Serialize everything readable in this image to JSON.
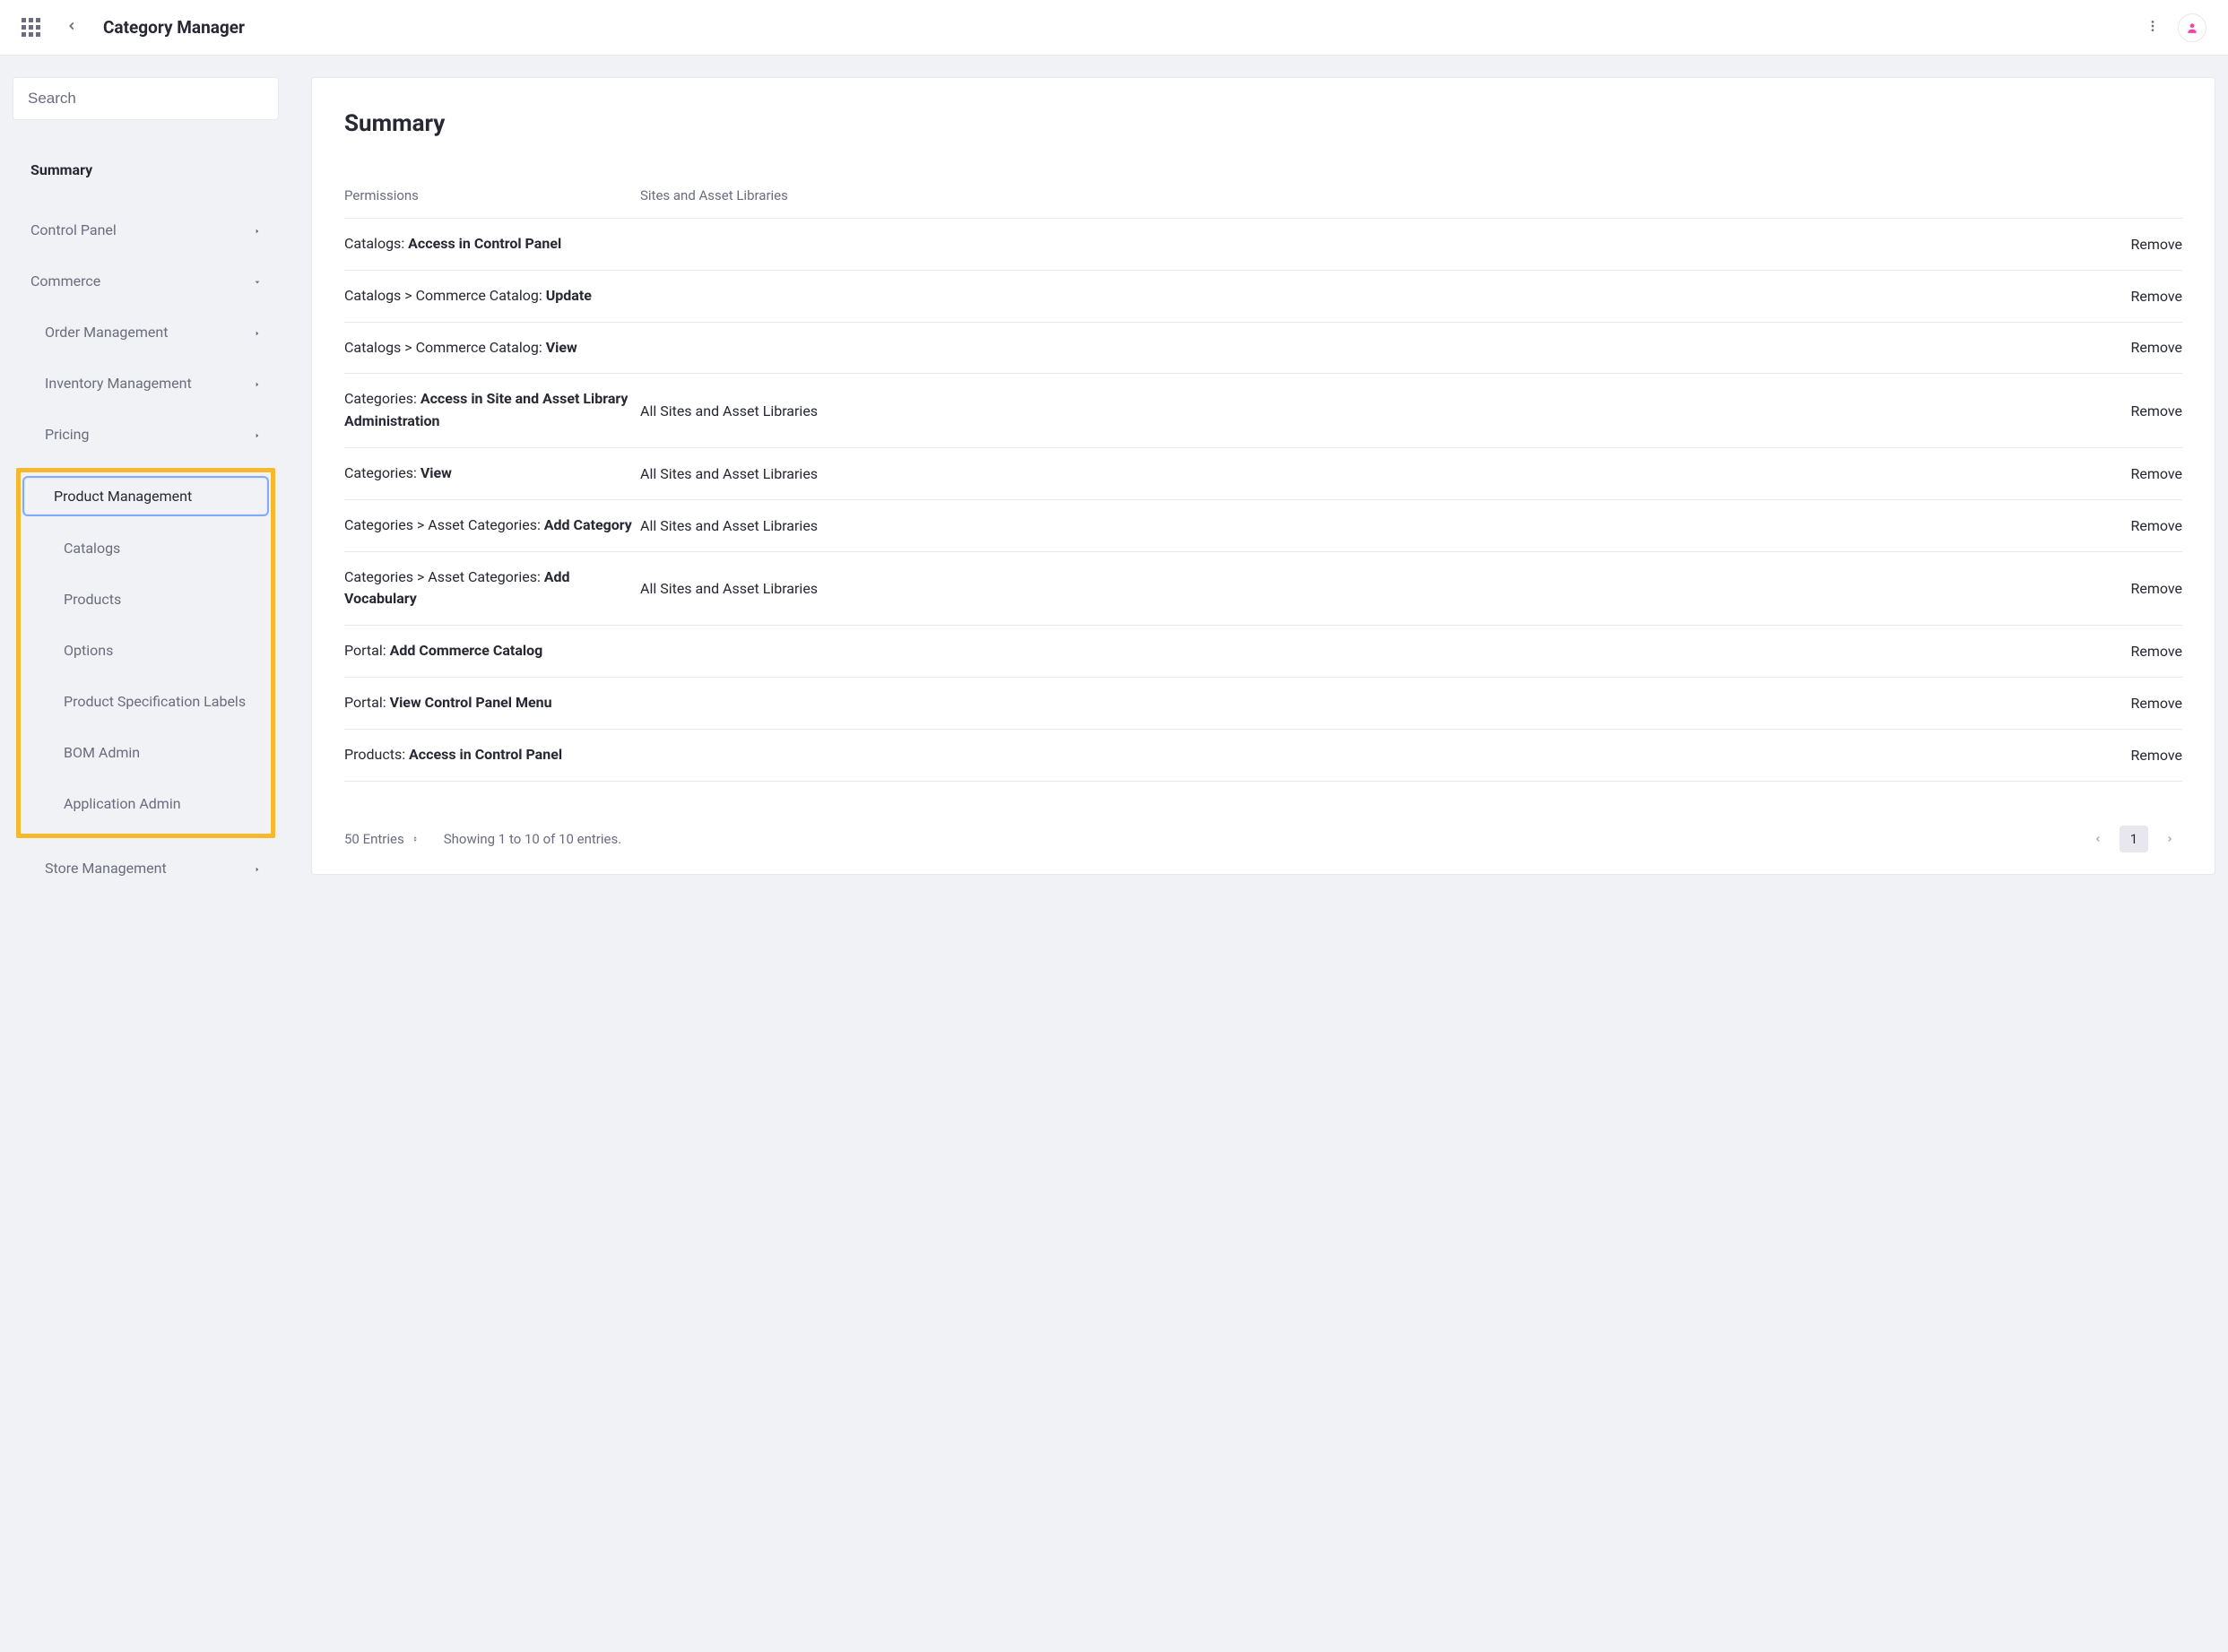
{
  "header": {
    "title": "Category Manager"
  },
  "sidebar": {
    "search_placeholder": "Search",
    "summary_label": "Summary",
    "items": {
      "control_panel": "Control Panel",
      "commerce": "Commerce",
      "order_management": "Order Management",
      "inventory_management": "Inventory Management",
      "pricing": "Pricing",
      "product_management": "Product Management",
      "catalogs": "Catalogs",
      "products": "Products",
      "options": "Options",
      "product_specification_labels": "Product Specification Labels",
      "bom_admin": "BOM Admin",
      "application_admin": "Application Admin",
      "store_management": "Store Management"
    }
  },
  "main": {
    "heading": "Summary",
    "columns": {
      "permissions": "Permissions",
      "sites": "Sites and Asset Libraries"
    },
    "rows": [
      {
        "prefix": "Catalogs: ",
        "bold": "Access in Control Panel",
        "sites": "",
        "action": "Remove"
      },
      {
        "prefix": "Catalogs > Commerce Catalog: ",
        "bold": "Update",
        "sites": "",
        "action": "Remove"
      },
      {
        "prefix": "Catalogs > Commerce Catalog: ",
        "bold": "View",
        "sites": "",
        "action": "Remove"
      },
      {
        "prefix": "Categories: ",
        "bold": "Access in Site and Asset Library Administration",
        "sites": "All Sites and Asset Libraries",
        "action": "Remove"
      },
      {
        "prefix": "Categories: ",
        "bold": "View",
        "sites": "All Sites and Asset Libraries",
        "action": "Remove"
      },
      {
        "prefix": "Categories > Asset Categories: ",
        "bold": "Add Category",
        "sites": "All Sites and Asset Libraries",
        "action": "Remove"
      },
      {
        "prefix": "Categories > Asset Categories: ",
        "bold": "Add Vocabulary",
        "sites": "All Sites and Asset Libraries",
        "action": "Remove"
      },
      {
        "prefix": "Portal: ",
        "bold": "Add Commerce Catalog",
        "sites": "",
        "action": "Remove"
      },
      {
        "prefix": "Portal: ",
        "bold": "View Control Panel Menu",
        "sites": "",
        "action": "Remove"
      },
      {
        "prefix": "Products: ",
        "bold": "Access in Control Panel",
        "sites": "",
        "action": "Remove"
      }
    ],
    "footer": {
      "entries": "50 Entries",
      "showing": "Showing 1 to 10 of 10 entries.",
      "page": "1"
    }
  }
}
